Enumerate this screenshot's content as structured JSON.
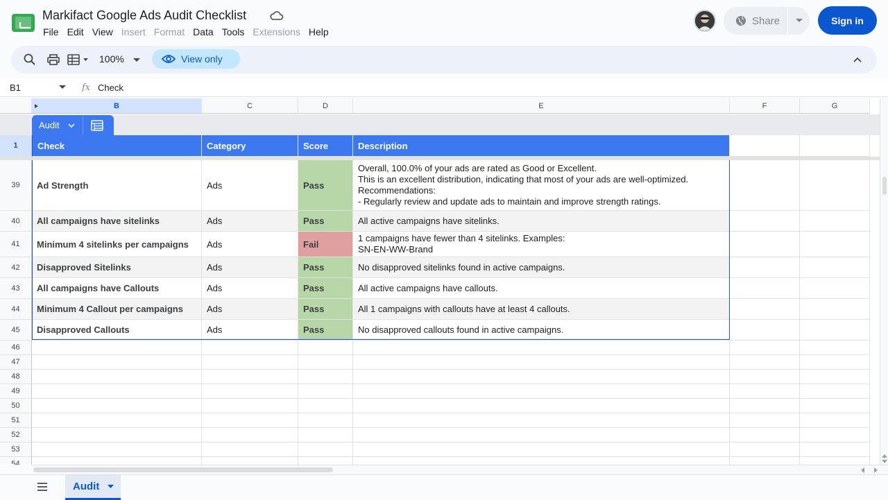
{
  "header": {
    "doc_title": "Markifact Google Ads Audit Checklist",
    "menu": [
      {
        "label": "File",
        "disabled": false
      },
      {
        "label": "Edit",
        "disabled": false
      },
      {
        "label": "View",
        "disabled": false
      },
      {
        "label": "Insert",
        "disabled": true
      },
      {
        "label": "Format",
        "disabled": true
      },
      {
        "label": "Data",
        "disabled": false
      },
      {
        "label": "Tools",
        "disabled": false
      },
      {
        "label": "Extensions",
        "disabled": true
      },
      {
        "label": "Help",
        "disabled": false
      }
    ],
    "share_label": "Share",
    "signin_label": "Sign in"
  },
  "toolbar": {
    "zoom": "100%",
    "view_only_label": "View only"
  },
  "formula_bar": {
    "name_box": "B1",
    "fx": "fx",
    "value": "Check"
  },
  "grid": {
    "columns": [
      "B",
      "C",
      "D",
      "E",
      "F",
      "G"
    ],
    "table_chip_label": "Audit",
    "header_row_number": "1",
    "headers": [
      "Check",
      "Category",
      "Score",
      "Description"
    ],
    "rows": [
      {
        "num": "39",
        "check": "Ad Strength",
        "category": "Ads",
        "score": "Pass",
        "description": "Overall, 100.0% of your ads are rated as Good or Excellent.\nThis is an excellent distribution, indicating that most of your ads are well-optimized.\nRecommendations:\n- Regularly review and update ads to maintain and improve strength ratings."
      },
      {
        "num": "40",
        "check": "All campaigns have sitelinks",
        "category": "Ads",
        "score": "Pass",
        "description": "All active campaigns have sitelinks."
      },
      {
        "num": "41",
        "check": "Minimum 4 sitelinks per campaigns",
        "category": "Ads",
        "score": "Fail",
        "description": "1 campaigns have fewer than 4 sitelinks. Examples:\nSN-EN-WW-Brand"
      },
      {
        "num": "42",
        "check": "Disapproved Sitelinks",
        "category": "Ads",
        "score": "Pass",
        "description": "No disapproved sitelinks found in active campaigns."
      },
      {
        "num": "43",
        "check": "All campaigns have Callouts",
        "category": "Ads",
        "score": "Pass",
        "description": "All active campaigns have callouts."
      },
      {
        "num": "44",
        "check": "Minimum 4 Callout per campaigns",
        "category": "Ads",
        "score": "Pass",
        "description": "All 1 campaigns with callouts have at least 4 callouts."
      },
      {
        "num": "45",
        "check": "Disapproved Callouts",
        "category": "Ads",
        "score": "Pass",
        "description": "No disapproved callouts found in active campaigns."
      }
    ],
    "empty_rows": [
      "46",
      "47",
      "48",
      "49",
      "50",
      "51",
      "52",
      "53",
      "54"
    ]
  },
  "colors": {
    "pass": "#b7d7a8",
    "fail": "#e0a0a0",
    "header_blue": "#3c78f0",
    "stripe": "#f3f3f3"
  },
  "bottom": {
    "sheet_tab": "Audit"
  }
}
